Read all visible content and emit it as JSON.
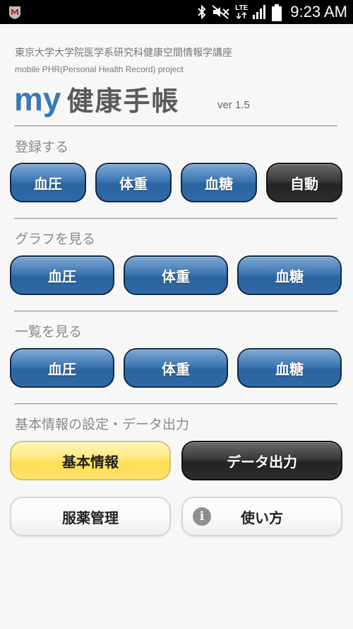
{
  "status_bar": {
    "time": "9:23 AM",
    "lte": "LTE",
    "icons": [
      "mcafee-icon",
      "bluetooth-icon",
      "mute-icon",
      "lte-icon",
      "signal-icon",
      "battery-icon"
    ]
  },
  "header": {
    "university": "東京大学大学院医学系研究科健康空間情報学講座",
    "project": "mobile PHR(Personal Health Record) project",
    "title_prefix": "my",
    "title_main": "健康手帳",
    "version": "ver 1.5"
  },
  "sections": {
    "register": {
      "label": "登録する",
      "buttons": [
        "血圧",
        "体重",
        "血糖",
        "自動"
      ]
    },
    "graph": {
      "label": "グラフを見る",
      "buttons": [
        "血圧",
        "体重",
        "血糖"
      ]
    },
    "list": {
      "label": "一覧を見る",
      "buttons": [
        "血圧",
        "体重",
        "血糖"
      ]
    },
    "settings": {
      "label": "基本情報の設定・データ出力",
      "basic_info": "基本情報",
      "data_output": "データ出力",
      "medication": "服薬管理",
      "how_to_use": "使い方",
      "info_glyph": "i"
    }
  },
  "colors": {
    "accent_blue": "#3a7ab4",
    "button_blue": "#2e6aa8",
    "button_dark": "#2c2c2c",
    "button_yellow": "#ffe26a",
    "background": "#f7f7f7"
  }
}
